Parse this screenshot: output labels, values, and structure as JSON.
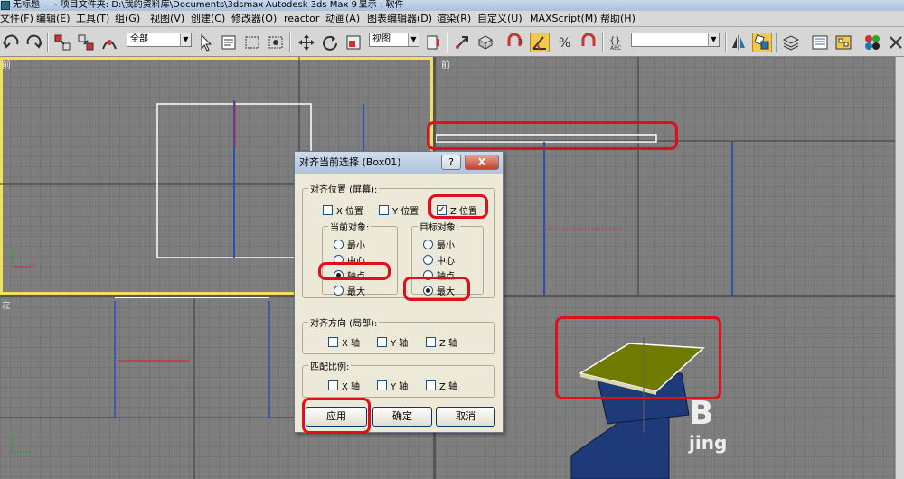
{
  "window": {
    "title_parts": [
      "无标题",
      "- 项目文件夹: D:\\我的资料库\\Documents\\3dsmax",
      "- Autodesk 3ds Max 9",
      "- 显示 : 软件"
    ]
  },
  "menubar": {
    "items": [
      "文件(F)",
      "编辑(E)",
      "工具(T)",
      "组(G)",
      "视图(V)",
      "创建(C)",
      "修改器(O)",
      "reactor",
      "动画(A)",
      "图表编辑器(D)",
      "渲染(R)",
      "自定义(U)",
      "MAXScript(M)",
      "帮助(H)"
    ]
  },
  "toolbar": {
    "selection_filter": "全部",
    "reference_coord": "视图",
    "named_selection": ""
  },
  "viewports": {
    "top_left_label": "前",
    "top_right_label": "前",
    "bottom_left_label": "左",
    "axis_y": "y",
    "axis_x": "x",
    "axis_z": "z"
  },
  "dialog": {
    "title": "对齐当前选择 (Box01)",
    "help_btn": "?",
    "close_btn": "X",
    "align_position": {
      "label": "对齐位置 (屏幕):",
      "x_label": "X 位置",
      "y_label": "Y 位置",
      "z_label": "Z 位置",
      "z_mark": "✓"
    },
    "current_object": {
      "label": "当前对象:",
      "options": [
        "最小",
        "中心",
        "轴点",
        "最大"
      ]
    },
    "target_object": {
      "label": "目标对象:",
      "options": [
        "最小",
        "中心",
        "轴点",
        "最大"
      ]
    },
    "align_orientation": {
      "label": "对齐方向 (局部):",
      "x": "X 轴",
      "y": "Y 轴",
      "z": "Z 轴"
    },
    "match_scale": {
      "label": "匹配比例:",
      "x": "X 轴",
      "y": "Y 轴",
      "z": "Z 轴"
    },
    "buttons": {
      "apply": "应用",
      "ok": "确定",
      "cancel": "取消"
    }
  },
  "watermark": {
    "line1": "B",
    "line2": "jing"
  },
  "colors": {
    "highlight": "#e0101a",
    "box_blue": "#1f3a78",
    "plate_olive": "#6f7a00",
    "active_viewport": "#f0e060"
  }
}
